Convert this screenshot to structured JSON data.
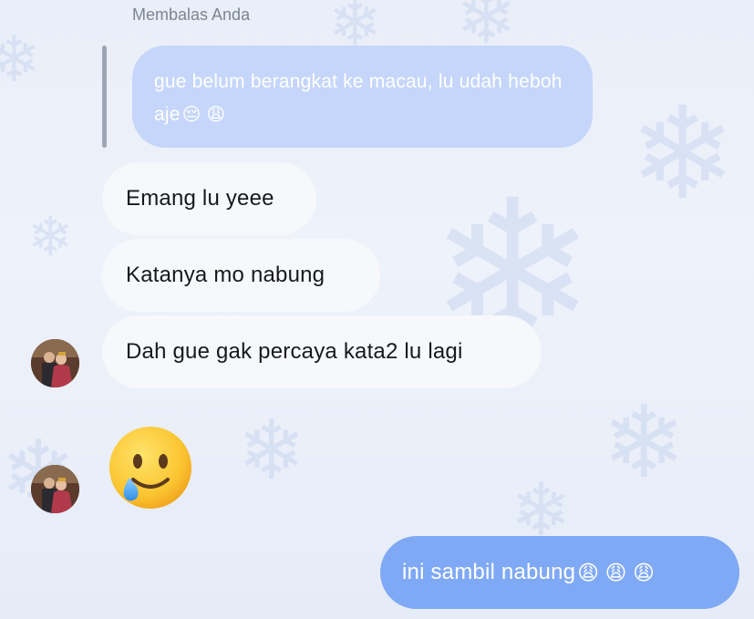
{
  "reply": {
    "label": "Membalas Anda",
    "quoted_text": "gue belum berangkat ke macau, lu udah heboh aje",
    "quoted_emojis": "😔 😩"
  },
  "messages_incoming": [
    {
      "text": "Emang lu yeee"
    },
    {
      "text": "Katanya mo nabung"
    },
    {
      "text": "Dah gue gak percaya kata2 lu lagi"
    }
  ],
  "sticker": {
    "emoji": "🥲",
    "icon": "smiling-face-with-tear-icon"
  },
  "message_outgoing": {
    "text": "ini sambil nabung",
    "emojis": "😩 😩 😩"
  },
  "colors": {
    "incoming_bubble": "#f7f8fb",
    "outgoing_bubble": "#7fa9f4",
    "reply_bubble": "#c5d6fa",
    "background": "#e9eef8"
  }
}
